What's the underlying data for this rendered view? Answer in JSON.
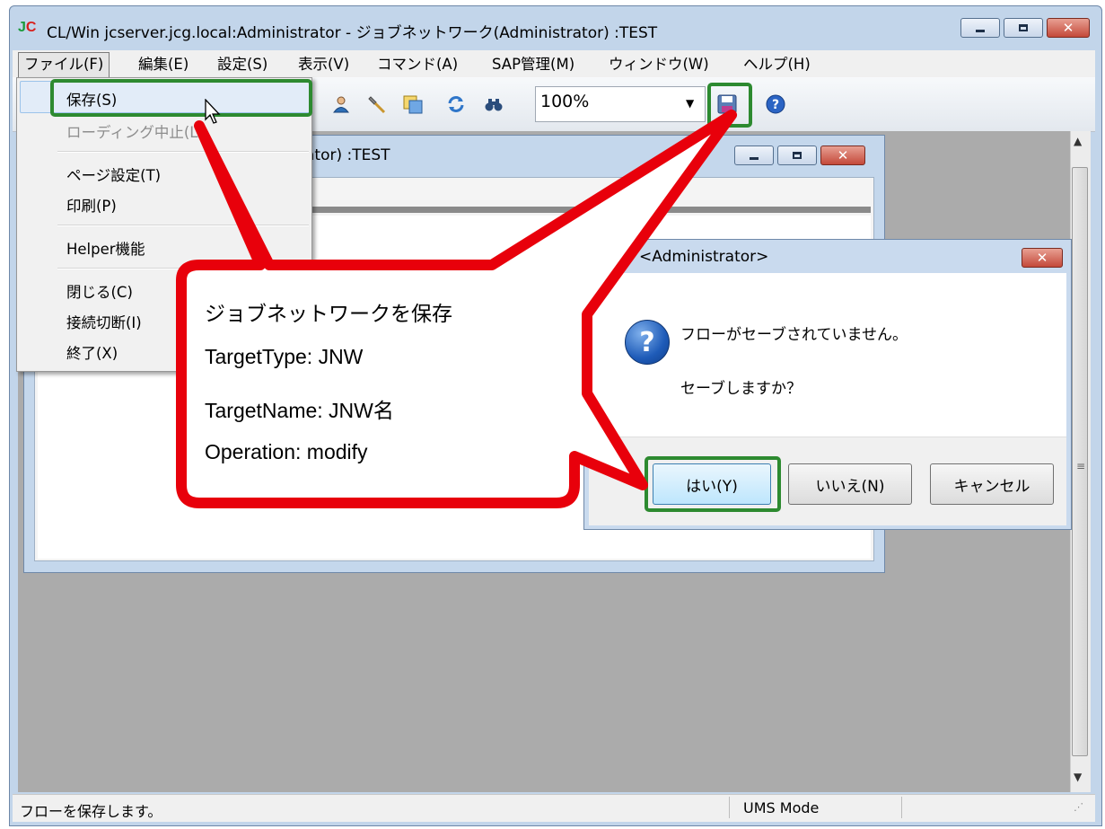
{
  "window": {
    "logo_j": "J",
    "logo_c": "C",
    "title": "CL/Win jcserver.jcg.local:Administrator - ジョブネットワーク(Administrator) :TEST"
  },
  "menubar": [
    {
      "id": "file",
      "label": "ファイル(F)"
    },
    {
      "id": "edit",
      "label": "編集(E)"
    },
    {
      "id": "settings",
      "label": "設定(S)"
    },
    {
      "id": "view",
      "label": "表示(V)"
    },
    {
      "id": "command",
      "label": "コマンド(A)"
    },
    {
      "id": "sap",
      "label": "SAP管理(M)"
    },
    {
      "id": "window",
      "label": "ウィンドウ(W)"
    },
    {
      "id": "help",
      "label": "ヘルプ(H)"
    }
  ],
  "toolbar": {
    "zoom_value": "100%",
    "icons": [
      "user-icon",
      "wrench-icon",
      "window-icon",
      "refresh-icon",
      "binoculars-icon",
      "save-icon",
      "help-icon"
    ]
  },
  "file_menu": {
    "save": "保存(S)",
    "stop_loading": "ローディング中止(L)",
    "page_setup": "ページ設定(T)",
    "print": "印刷(P)",
    "helper": "Helper機能",
    "close": "閉じる(C)",
    "disconnect": "接続切断(I)",
    "exit": "終了(X)"
  },
  "child_window": {
    "title": "ator) :TEST"
  },
  "dialog": {
    "title": "<Administrator>",
    "message_line1": "フローがセーブされていません。",
    "message_line2": "セーブしますか？",
    "yes": "はい(Y)",
    "no": "いいえ(N)",
    "cancel": "キャンセル"
  },
  "callout": {
    "title": "ジョブネットワークを保存",
    "line1": "TargetType: JNW",
    "line2": "TargetName: JNW名",
    "line3": "Operation: modify"
  },
  "statusbar": {
    "message": "フローを保存します。",
    "mode": "UMS Mode"
  },
  "colors": {
    "annotation_red": "#e8000b",
    "highlight_green": "#2d8a30",
    "mdi_background": "#ababab"
  }
}
